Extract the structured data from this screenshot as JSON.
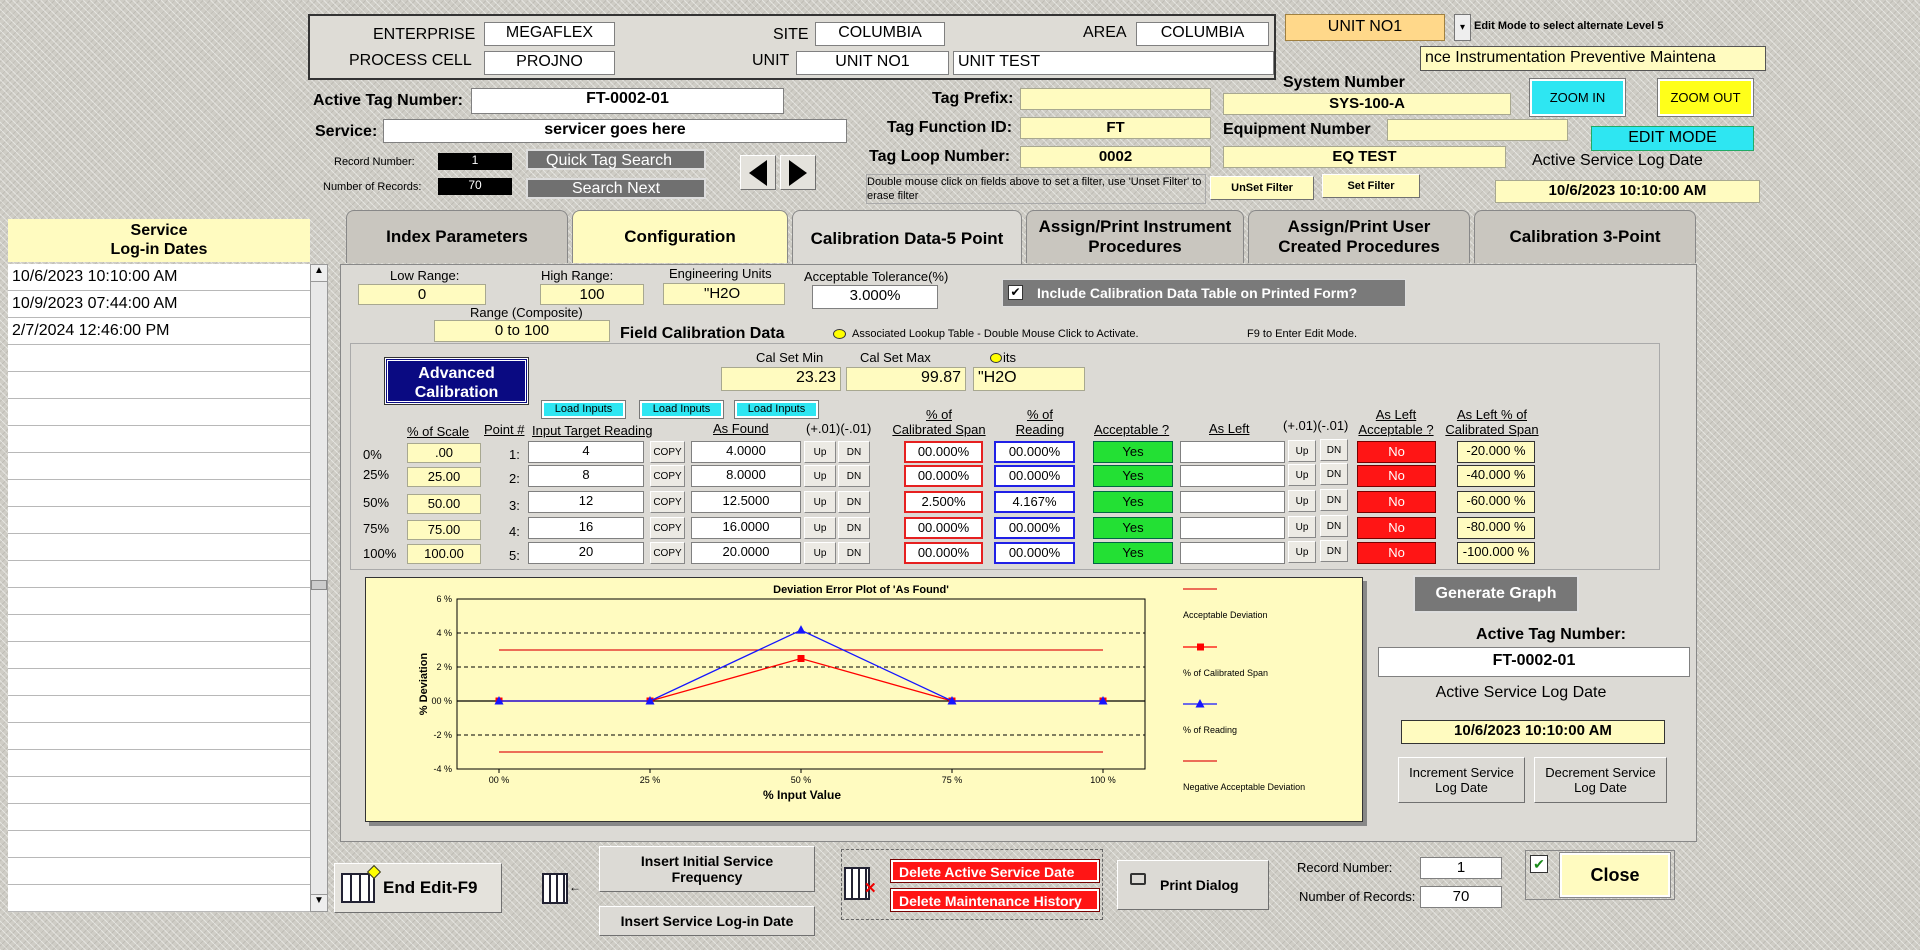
{
  "header": {
    "enterprise_label": "ENTERPRISE",
    "enterprise": "MEGAFLEX",
    "site_label": "SITE",
    "site": "COLUMBIA",
    "area_label": "AREA",
    "area": "COLUMBIA",
    "process_cell_label": "PROCESS CELL",
    "process_cell": "PROJNO",
    "unit_label": "UNIT",
    "unit": "UNIT NO1",
    "unit_desc": "UNIT TEST",
    "unit_select": "UNIT NO1",
    "edit_mode_hint": "Edit Mode to select alternate Level 5",
    "maint_title": "nce  Instrumentation Preventive Maintena"
  },
  "tag": {
    "active_tag_label": "Active Tag Number:",
    "active_tag": "FT-0002-01",
    "service_label": "Service:",
    "service": "servicer goes here",
    "record_number_label": "Record Number:",
    "record_number": "1",
    "number_of_records_label": "Number of Records:",
    "number_of_records": "70",
    "quick_search": "Quick Tag Search",
    "search_next": "Search Next",
    "prefix_label": "Tag Prefix:",
    "prefix": "",
    "function_label": "Tag Function ID:",
    "function": "FT",
    "loop_label": "Tag Loop Number:",
    "loop": "0002",
    "filter_hint": "Double mouse click on fields above to set a filter, use 'Unset Filter' to erase filter",
    "unset_filter": "UnSet Filter",
    "set_filter": "Set Filter",
    "system_number_label": "System Number",
    "system_number": "SYS-100-A",
    "equipment_number_label": "Equipment Number",
    "equipment_number": "",
    "eq_test": "EQ TEST",
    "zoom_in": "ZOOM IN",
    "zoom_out": "ZOOM OUT",
    "edit_mode": "EDIT MODE",
    "active_log_label": "Active Service Log Date",
    "active_log": "10/6/2023 10:10:00 AM"
  },
  "sidebar": {
    "title_line1": "Service",
    "title_line2": "Log-in Dates",
    "dates": [
      "10/6/2023 10:10:00 AM",
      "10/9/2023 07:44:00 AM",
      "2/7/2024 12:46:00 PM"
    ]
  },
  "tabs": [
    {
      "label": "Index Parameters"
    },
    {
      "label": "Configuration"
    },
    {
      "label": "Calibration Data-5 Point"
    },
    {
      "label": "Assign/Print Instrument Procedures"
    },
    {
      "label": "Assign/Print User Created Procedures"
    },
    {
      "label": "Calibration 3-Point"
    }
  ],
  "range": {
    "low_label": "Low Range:",
    "low": "0",
    "high_label": "High Range:",
    "high": "100",
    "eu_label": "Engineering Units",
    "eu": "\"H2O",
    "tol_label": "Acceptable Tolerance(%)",
    "tol": "3.000%",
    "composite_label": "Range (Composite)",
    "composite": "0 to 100",
    "include_label": "Include Calibration Data Table on Printed Form?",
    "field_cal_label": "Field Calibration Data",
    "lookup_hint": "Associated Lookup Table - Double Mouse Click to Activate.",
    "f9_hint": "F9 to Enter Edit Mode."
  },
  "cal": {
    "advanced_line1": "Advanced",
    "advanced_line2": "Calibration",
    "set_min_label": "Cal Set Min",
    "set_min": "23.23",
    "set_max_label": "Cal Set Max",
    "set_max": "99.87",
    "units_label": "its",
    "units": "\"H2O",
    "load_inputs": "Load Inputs",
    "h_scale": "% of Scale",
    "h_point": "Point #",
    "h_target": "Input Target Reading",
    "h_found": "As Found",
    "h_inc": "(+.01)(-.01)",
    "h_span1": "% of",
    "h_span2": "Calibrated Span",
    "h_read1": "% of",
    "h_read2": "Reading",
    "h_acc": "Acceptable ?",
    "h_left": "As Left",
    "h_inc2": "(+.01)(-.01)",
    "h_lacc1": "As Left",
    "h_lacc2": "Acceptable ?",
    "h_lspan1": "As Left % of",
    "h_lspan2": "Calibrated Span",
    "copy": "COPY",
    "up": "Up",
    "dn": "DN",
    "rows": [
      {
        "pct": "0%",
        "scale": ".00",
        "point": "1:",
        "target": "4",
        "found": "4.0000",
        "span": "00.000%",
        "reading": "00.000%",
        "acc": "Yes",
        "left": "",
        "lacc": "No",
        "lspan": "-20.000 %"
      },
      {
        "pct": "25%",
        "scale": "25.00",
        "point": "2:",
        "target": "8",
        "found": "8.0000",
        "span": "00.000%",
        "reading": "00.000%",
        "acc": "Yes",
        "left": "",
        "lacc": "No",
        "lspan": "-40.000 %"
      },
      {
        "pct": "50%",
        "scale": "50.00",
        "point": "3:",
        "target": "12",
        "found": "12.5000",
        "span": "2.500%",
        "reading": "4.167%",
        "acc": "Yes",
        "left": "",
        "lacc": "No",
        "lspan": "-60.000 %"
      },
      {
        "pct": "75%",
        "scale": "75.00",
        "point": "4:",
        "target": "16",
        "found": "16.0000",
        "span": "00.000%",
        "reading": "00.000%",
        "acc": "Yes",
        "left": "",
        "lacc": "No",
        "lspan": "-80.000 %"
      },
      {
        "pct": "100%",
        "scale": "100.00",
        "point": "5:",
        "target": "20",
        "found": "20.0000",
        "span": "00.000%",
        "reading": "00.000%",
        "acc": "Yes",
        "left": "",
        "lacc": "No",
        "lspan": "-100.000 %"
      }
    ]
  },
  "chart_data": {
    "type": "line",
    "title": "Deviation Error Plot of 'As Found'",
    "xlabel": "% Input Value",
    "ylabel": "% Deviation",
    "x": [
      0,
      25,
      50,
      75,
      100
    ],
    "xticks": [
      "00 %",
      "25 %",
      "50 %",
      "75 %",
      "100 %"
    ],
    "yticks": [
      "6 %",
      "4 %",
      "2 %",
      "00 %",
      "-2 %",
      "-4 %"
    ],
    "ylim": [
      -4,
      6
    ],
    "grid": "dashed horizontal",
    "legend_position": "right",
    "series": [
      {
        "name": "Acceptable Deviation",
        "values": [
          3,
          3,
          3,
          3,
          3
        ],
        "color": "#e01818",
        "marker": "none"
      },
      {
        "name": "% of Calibrated Span",
        "values": [
          0,
          0,
          2.5,
          0,
          0
        ],
        "color": "#ff0000",
        "marker": "square"
      },
      {
        "name": "% of Reading",
        "values": [
          0,
          0,
          4.167,
          0,
          0
        ],
        "color": "#1515ff",
        "marker": "triangle"
      },
      {
        "name": "Negative Acceptable Deviation",
        "values": [
          -3,
          -3,
          -3,
          -3,
          -3
        ],
        "color": "#e01818",
        "marker": "none"
      }
    ]
  },
  "right_panel": {
    "generate_graph": "Generate Graph",
    "active_tag_label": "Active Tag Number:",
    "active_tag": "FT-0002-01",
    "active_log_label": "Active Service Log Date",
    "active_log": "10/6/2023 10:10:00 AM",
    "increment": "Increment Service Log Date",
    "decrement": "Decrement Service Log Date"
  },
  "footer": {
    "end_edit": "End Edit-F9",
    "insert_freq": "Insert Initial Service Frequency",
    "insert_login": "Insert Service Log-in Date",
    "delete_active": "Delete Active Service Date",
    "delete_history": "Delete Maintenance History",
    "print_dialog": "Print Dialog",
    "record_number_label": "Record Number:",
    "record_number": "1",
    "number_of_records_label": "Number of Records:",
    "number_of_records": "70",
    "close": "Close"
  },
  "colors": {
    "yellow_field": "#fffbc0",
    "cyan_button": "#2ee6f2",
    "navy": "#0a0a82",
    "red": "#ff1515",
    "green": "#23e034"
  }
}
